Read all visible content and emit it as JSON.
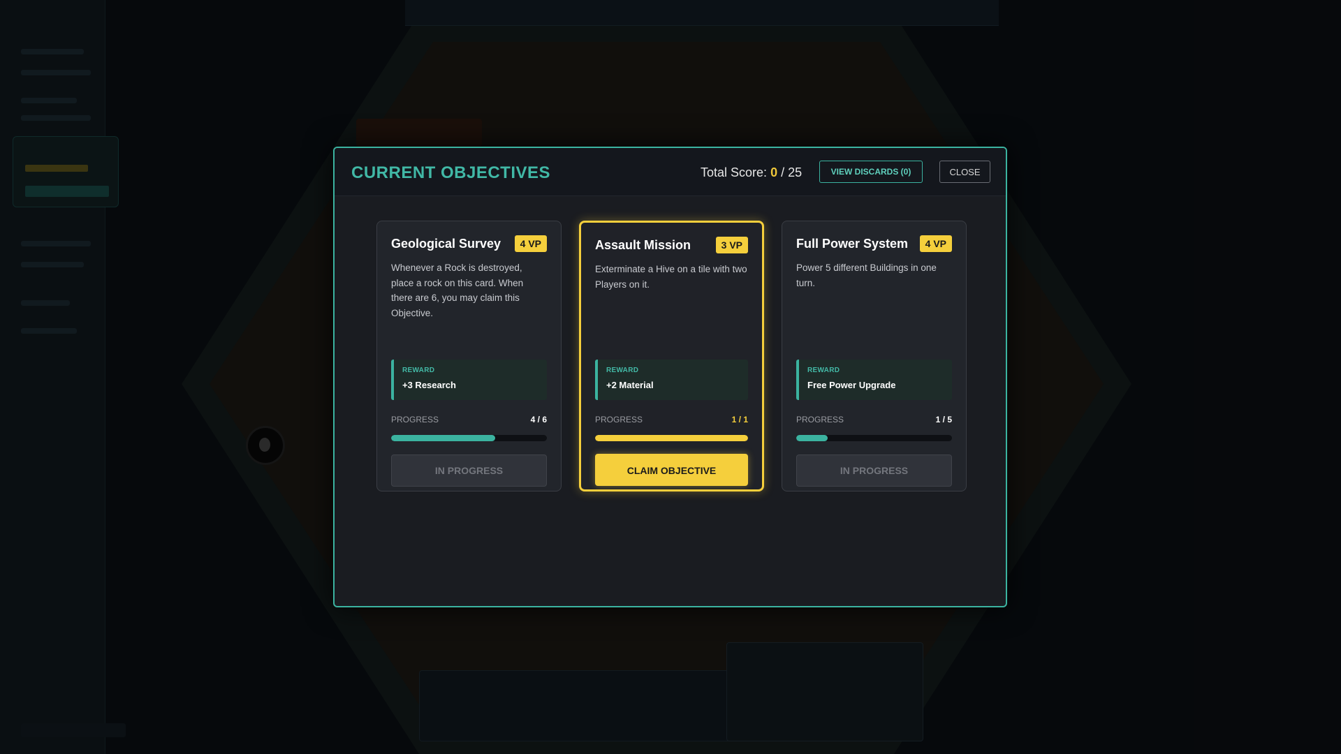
{
  "modal": {
    "title": "CURRENT OBJECTIVES",
    "score_label": "Total Score:",
    "score_current": "0",
    "score_separator": " / ",
    "score_max": "25",
    "view_discards_label": "VIEW DISCARDS (0)",
    "close_label": "CLOSE"
  },
  "cards": [
    {
      "title": "Geological Survey",
      "vp": "4 VP",
      "description": "Whenever a Rock is destroyed, place a rock on this card. When there are 6, you may claim this Objective.",
      "reward_label": "REWARD",
      "reward": "+3 Research",
      "progress_label": "PROGRESS",
      "progress_text": "4 / 6",
      "progress_value": 4,
      "progress_max": 6,
      "button_label": "IN PROGRESS",
      "claimable": false
    },
    {
      "title": "Assault Mission",
      "vp": "3 VP",
      "description": "Exterminate a Hive on a tile with two Players on it.",
      "reward_label": "REWARD",
      "reward": "+2 Material",
      "progress_label": "PROGRESS",
      "progress_text": "1 / 1",
      "progress_value": 1,
      "progress_max": 1,
      "button_label": "CLAIM OBJECTIVE",
      "claimable": true
    },
    {
      "title": "Full Power System",
      "vp": "4 VP",
      "description": "Power 5 different Buildings in one turn.",
      "reward_label": "REWARD",
      "reward": "Free Power Upgrade",
      "progress_label": "PROGRESS",
      "progress_text": "1 / 5",
      "progress_value": 1,
      "progress_max": 5,
      "button_label": "IN PROGRESS",
      "claimable": false
    }
  ],
  "colors": {
    "accent_teal": "#3bb3a0",
    "accent_gold": "#f5cf3c",
    "modal_bg": "#1a1c21"
  }
}
